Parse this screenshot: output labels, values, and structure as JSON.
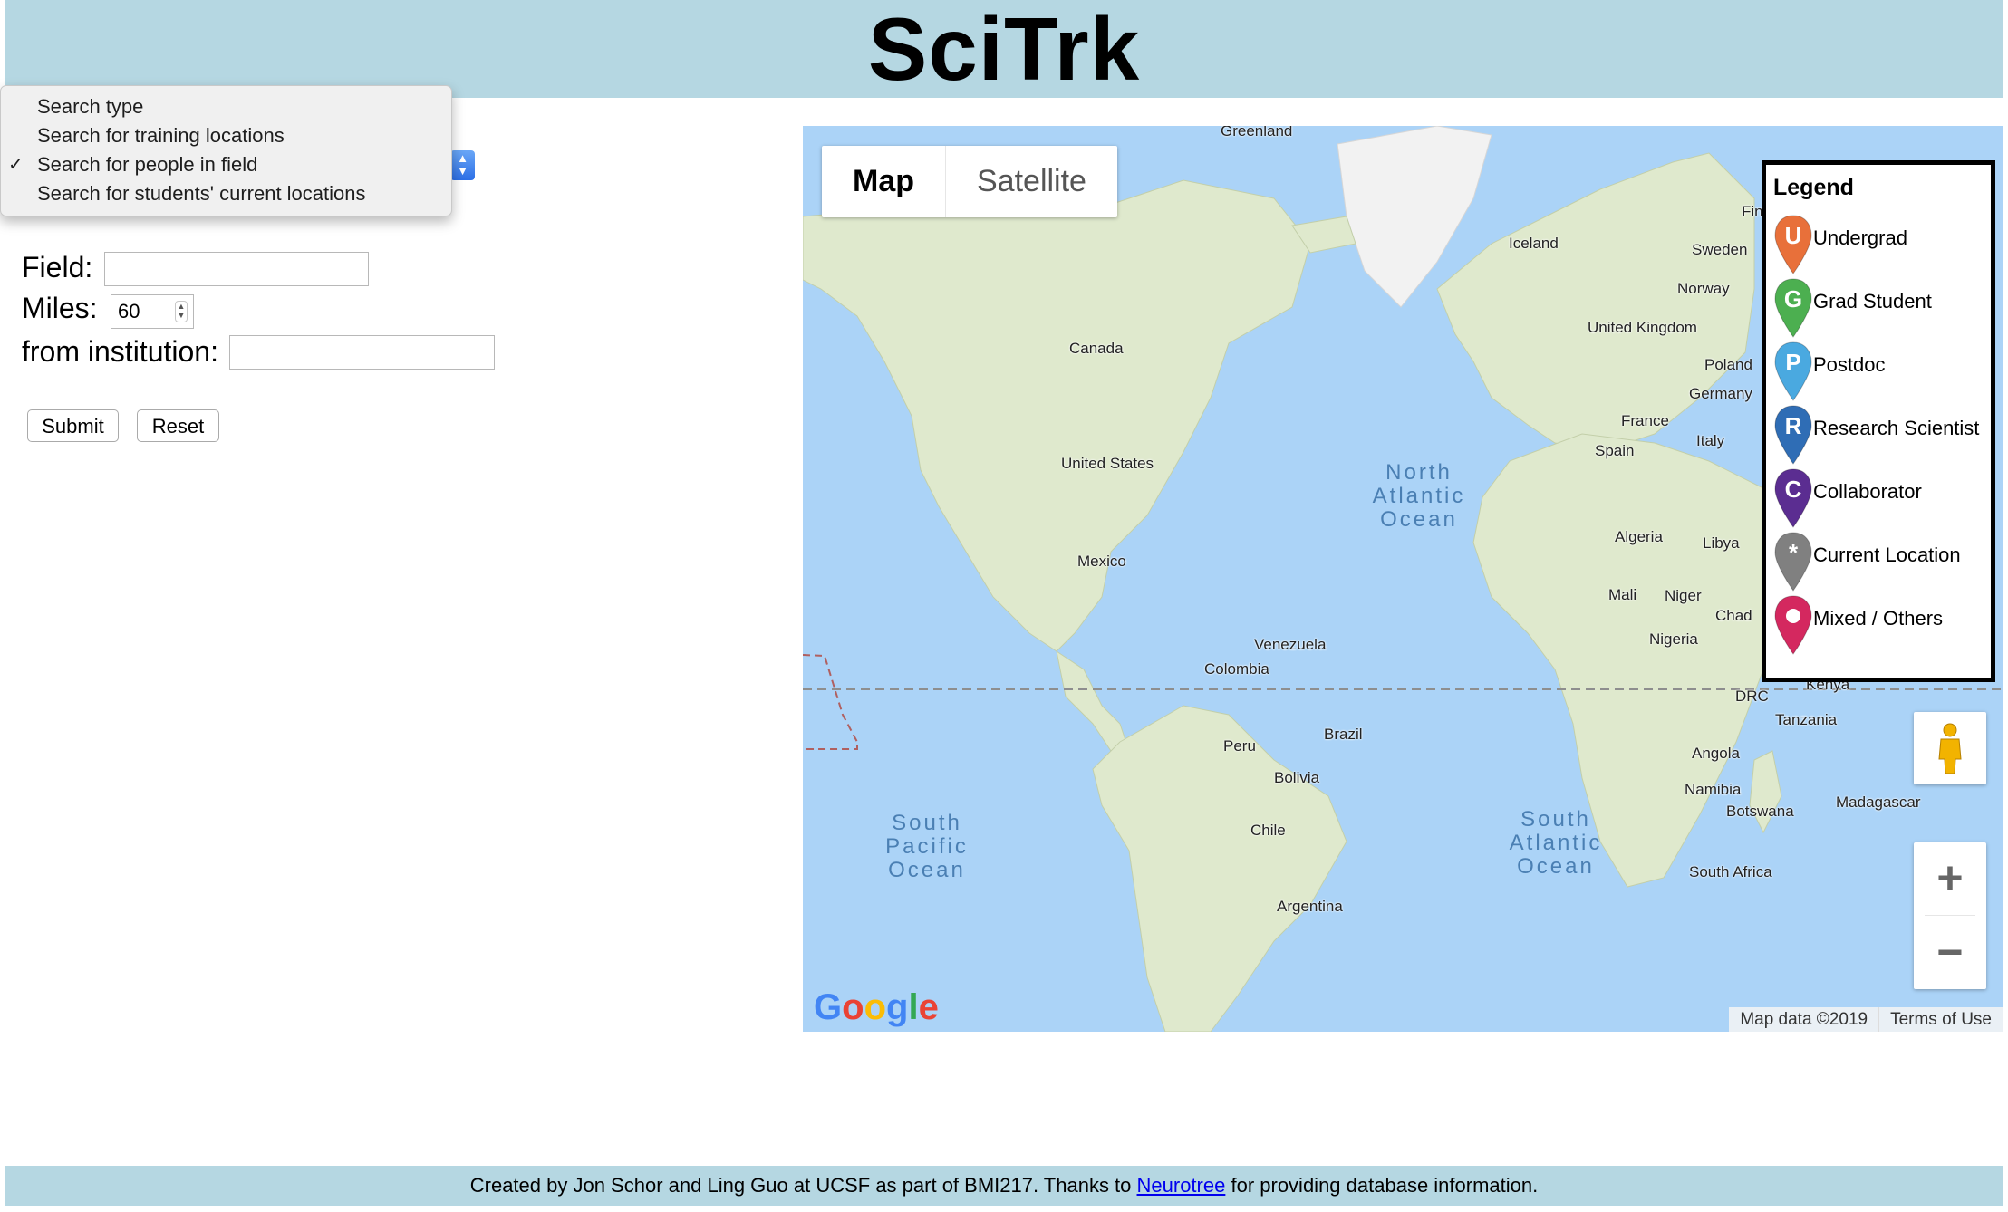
{
  "header": {
    "title": "SciTrk"
  },
  "search": {
    "select": {
      "options": [
        "Search type",
        "Search for training locations",
        "Search for people in field",
        "Search for students' current locations"
      ],
      "checkmark": "✓"
    },
    "field_label": "Field:",
    "field_value": "",
    "miles_label": "Miles:",
    "miles_value": "60",
    "institution_label": "from institution:",
    "institution_value": "",
    "submit_label": "Submit",
    "reset_label": "Reset"
  },
  "map": {
    "type_buttons": [
      "Map",
      "Satellite"
    ],
    "active_type": "Map",
    "labels": [
      "Greenland",
      "Iceland",
      "Sweden",
      "Norway",
      "Fin",
      "United Kingdom",
      "Poland",
      "Germany",
      "France",
      "Spain",
      "Italy",
      "Canada",
      "United States",
      "Mexico",
      "Venezuela",
      "Colombia",
      "Brazil",
      "Peru",
      "Bolivia",
      "Chile",
      "Argentina",
      "Algeria",
      "Libya",
      "Mali",
      "Niger",
      "Chad",
      "Nigeria",
      "DRC",
      "Kenya",
      "Tanzania",
      "Angola",
      "Namibia",
      "Botswana",
      "Madagascar",
      "South Africa"
    ],
    "oceans": {
      "north_atlantic": "North Atlantic Ocean",
      "south_pacific": "South Pacific Ocean",
      "south_atlantic": "South Atlantic Ocean"
    },
    "zoom_in": "+",
    "zoom_out": "−",
    "attribution_data": "Map data ©2019",
    "attribution_terms": "Terms of Use",
    "google_logo": "Google"
  },
  "legend": {
    "title": "Legend",
    "items": [
      {
        "letter": "U",
        "label": "Undergrad",
        "color": "#e8703a"
      },
      {
        "letter": "G",
        "label": "Grad Student",
        "color": "#4caf50"
      },
      {
        "letter": "P",
        "label": "Postdoc",
        "color": "#4aa9e0"
      },
      {
        "letter": "R",
        "label": "Research Scientist",
        "color": "#2f6db5"
      },
      {
        "letter": "C",
        "label": "Collaborator",
        "color": "#5b2d91"
      },
      {
        "letter": "*",
        "label": "Current Location",
        "color": "#808080"
      },
      {
        "letter": "",
        "label": "Mixed / Others",
        "color": "#d4285f"
      }
    ]
  },
  "footer": {
    "text_before": "Created by Jon Schor and Ling Guo at UCSF as part of BMI217. Thanks to ",
    "link": "Neurotree",
    "text_after": " for providing database information."
  },
  "colors": {
    "header_bg": "#b5d7e2",
    "ocean": "#abd3f7",
    "land": "#e9efdc",
    "link": "#0000ee"
  }
}
